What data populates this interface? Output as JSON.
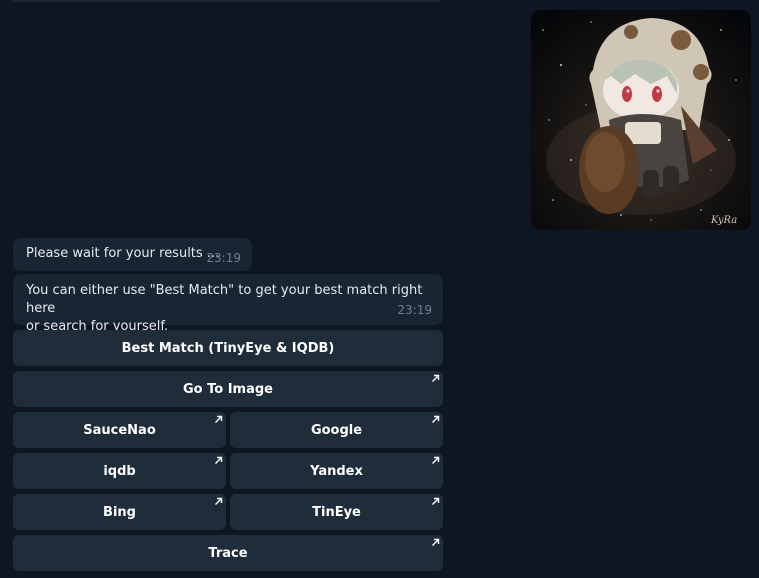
{
  "messages": {
    "wait": {
      "text": "Please wait for your results ...",
      "time": "23:19"
    },
    "info": {
      "line1": "You can either use \"Best Match\" to get your best match right here",
      "line2": "or search for yourself.",
      "time": "23:19"
    }
  },
  "photo": {
    "signature": "KyRa",
    "icon": "chibi-character-illustration"
  },
  "keyboard": {
    "best_match": "Best Match (TinyEye & IQDB)",
    "go_to_image": "Go To Image",
    "saucenao": "SauceNao",
    "google": "Google",
    "iqdb": "iqdb",
    "yandex": "Yandex",
    "bing": "Bing",
    "tineye": "TinEye",
    "trace": "Trace"
  },
  "colors": {
    "background": "#0e1621",
    "bubble": "#182533",
    "button": "#1f2c39",
    "timestamp": "#6d7f8f"
  }
}
